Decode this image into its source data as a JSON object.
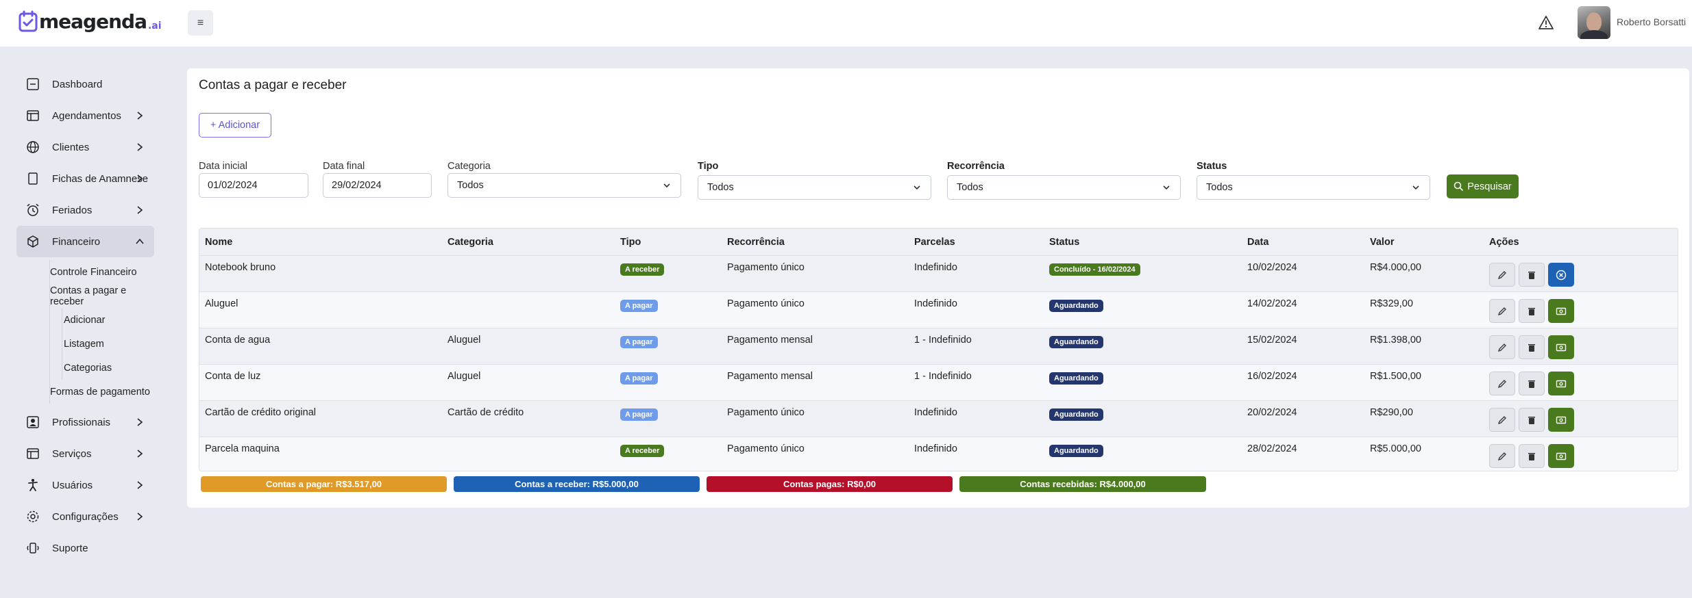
{
  "brand": {
    "name": "meagenda",
    "suffix": ".ai",
    "accent": "#6b57e8"
  },
  "header": {
    "menu_icon": "≡",
    "user_name": "Roberto Borsatti"
  },
  "sidebar": {
    "items": [
      {
        "label": "Dashboard",
        "icon": "dashboard-icon"
      },
      {
        "label": "Agendamentos",
        "icon": "calendar-icon"
      },
      {
        "label": "Clientes",
        "icon": "globe-icon"
      },
      {
        "label": "Fichas de Anamnese",
        "icon": "file-icon"
      },
      {
        "label": "Feriados",
        "icon": "alarm-clock-icon"
      },
      {
        "label": "Financeiro",
        "icon": "box-icon"
      },
      {
        "label": "Profissionais",
        "icon": "user-card-icon"
      },
      {
        "label": "Serviços",
        "icon": "services-icon"
      },
      {
        "label": "Usuários",
        "icon": "person-icon"
      },
      {
        "label": "Configurações",
        "icon": "gear-icon"
      },
      {
        "label": "Suporte",
        "icon": "phone-vibrate-icon"
      }
    ],
    "financeiro_sub": {
      "controle": "Controle Financeiro",
      "contas": "Contas a pagar e receber",
      "contas_sub": [
        "Adicionar",
        "Listagem",
        "Categorias"
      ],
      "formas": "Formas de pagamento"
    }
  },
  "page": {
    "title": "Contas a pagar e receber",
    "add_label": "+ Adicionar"
  },
  "filters": {
    "data_inicial": {
      "label": "Data inicial",
      "value": "01/02/2024"
    },
    "data_final": {
      "label": "Data final",
      "value": "29/02/2024"
    },
    "categoria": {
      "label": "Categoria",
      "value": "Todos"
    },
    "tipo": {
      "label": "Tipo",
      "value": "Todos"
    },
    "recorrencia": {
      "label": "Recorrência",
      "value": "Todos"
    },
    "status": {
      "label": "Status",
      "value": "Todos"
    },
    "search_label": "Pesquisar"
  },
  "table": {
    "headers": [
      "Nome",
      "Categoria",
      "Tipo",
      "Recorrência",
      "Parcelas",
      "Status",
      "Data",
      "Valor",
      "Ações"
    ],
    "rows": [
      {
        "nome": "Notebook bruno",
        "categoria": "",
        "tipo": "A receber",
        "recorrencia": "Pagamento único",
        "parcelas": "Indefinido",
        "status": "Concluído - 16/02/2024",
        "data": "10/02/2024",
        "valor": "R$4.000,00"
      },
      {
        "nome": "Aluguel",
        "categoria": "",
        "tipo": "A pagar",
        "recorrencia": "Pagamento único",
        "parcelas": "Indefinido",
        "status": "Aguardando",
        "data": "14/02/2024",
        "valor": "R$329,00"
      },
      {
        "nome": "Conta de agua",
        "categoria": "Aluguel",
        "tipo": "A pagar",
        "recorrencia": "Pagamento mensal",
        "parcelas": "1 - Indefinido",
        "status": "Aguardando",
        "data": "15/02/2024",
        "valor": "R$1.398,00"
      },
      {
        "nome": "Conta de luz",
        "categoria": "Aluguel",
        "tipo": "A pagar",
        "recorrencia": "Pagamento mensal",
        "parcelas": "1 - Indefinido",
        "status": "Aguardando",
        "data": "16/02/2024",
        "valor": "R$1.500,00"
      },
      {
        "nome": "Cartão de crédito original",
        "categoria": "Cartão de crédito",
        "tipo": "A pagar",
        "recorrencia": "Pagamento único",
        "parcelas": "Indefinido",
        "status": "Aguardando",
        "data": "20/02/2024",
        "valor": "R$290,00"
      },
      {
        "nome": "Parcela maquina",
        "categoria": "",
        "tipo": "A receber",
        "recorrencia": "Pagamento único",
        "parcelas": "Indefinido",
        "status": "Aguardando",
        "data": "28/02/2024",
        "valor": "R$5.000,00"
      }
    ]
  },
  "summary": {
    "pagar": {
      "label": "Contas a pagar: R$3.517,00",
      "color": "#e09a28"
    },
    "receber": {
      "label": "Contas a receber: R$5.000,00",
      "color": "#1d62b4"
    },
    "pagas": {
      "label": "Contas pagas: R$0,00",
      "color": "#b4102a"
    },
    "recebidas": {
      "label": "Contas recebidas: R$4.000,00",
      "color": "#4a7a1e"
    }
  }
}
